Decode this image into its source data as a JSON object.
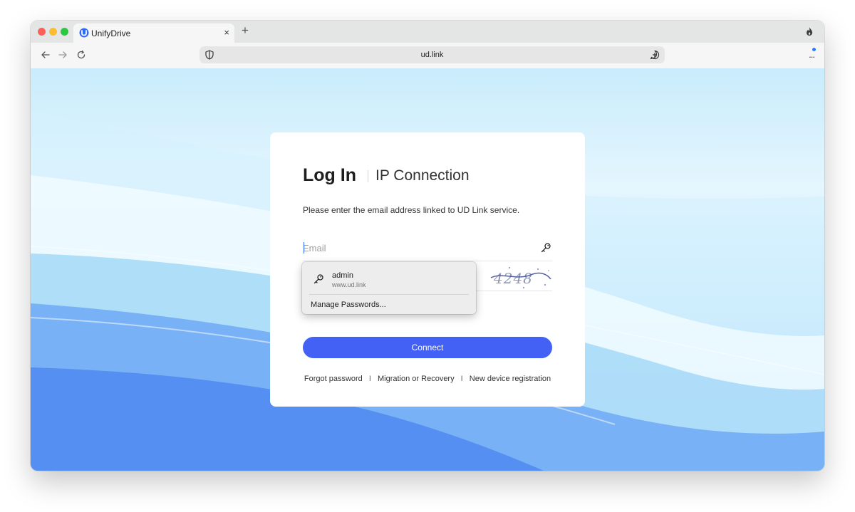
{
  "browser": {
    "tab_title": "UnifyDrive",
    "tab_close": "×",
    "new_tab": "+",
    "url": "ud.link",
    "menu": "..."
  },
  "login": {
    "title": "Log In",
    "subtitle": "IP Connection",
    "instruction": "Please enter the email address linked to UD Link service.",
    "email_placeholder": "Email",
    "captcha_text": "4248",
    "connect_label": "Connect",
    "links": [
      "Forgot password",
      "Migration or Recovery",
      "New device registration"
    ],
    "link_separator": "I"
  },
  "autofill": {
    "username": "admin",
    "site": "www.ud.link",
    "manage_label": "Manage Passwords..."
  },
  "colors": {
    "accent": "#4361f5",
    "tab_strip": "#e4e6e6",
    "traffic_red": "#ff5f57",
    "traffic_yellow": "#febc2e",
    "traffic_green": "#28c840"
  },
  "icons": [
    "unifydrive-logo-icon",
    "close-icon",
    "plus-icon",
    "flame-icon",
    "back-arrow-icon",
    "forward-arrow-icon",
    "reload-icon",
    "shield-icon",
    "add-bubble-icon",
    "more-menu-icon",
    "key-icon"
  ]
}
